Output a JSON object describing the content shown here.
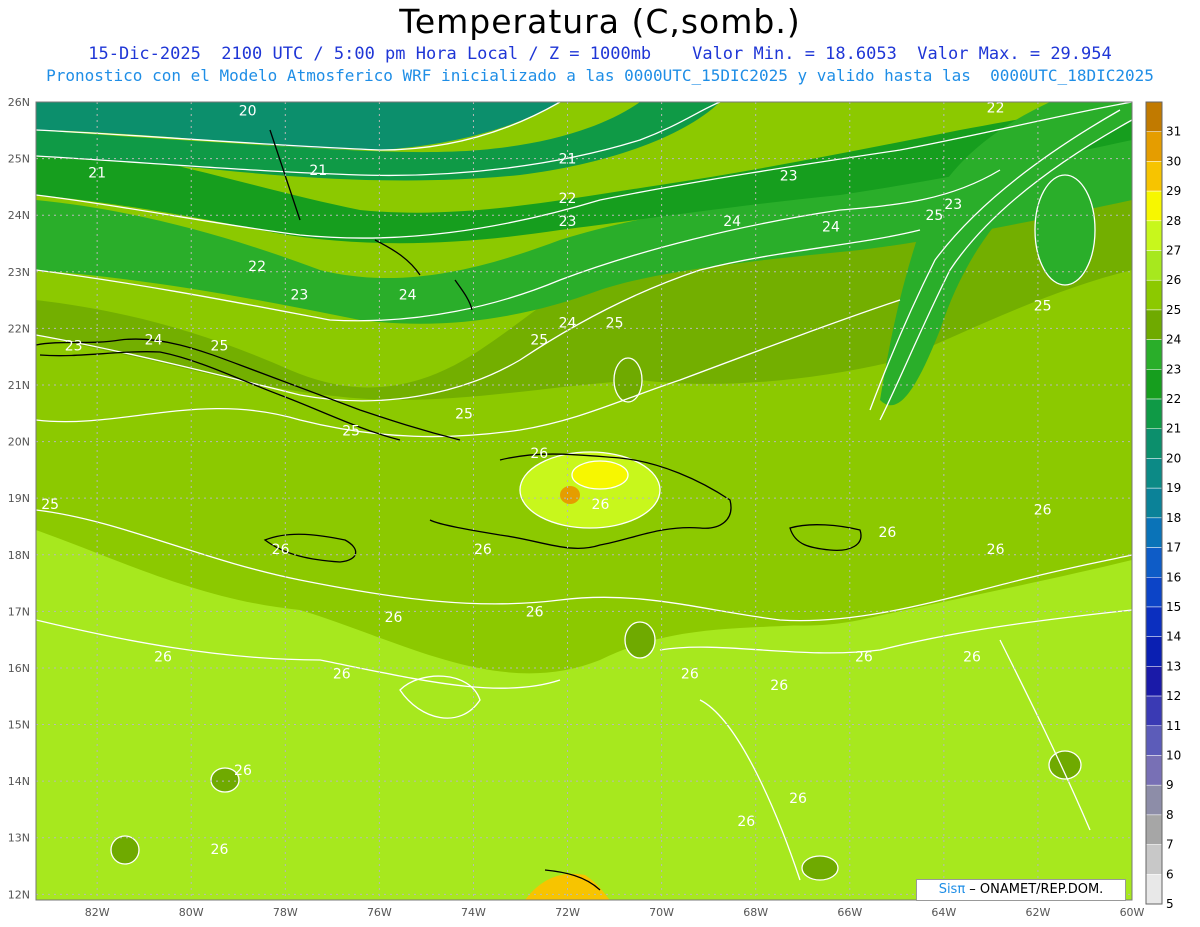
{
  "header": {
    "title": "Temperatura (C,somb.)",
    "line1": "15-Dic-2025  2100 UTC / 5:00 pm Hora Local / Z = 1000mb    Valor Min. = 18.6053  Valor Max. = 29.954",
    "line2": "Pronostico con el Modelo Atmosferico WRF inicializado a las 0000UTC_15DIC2025 y valido hasta las  0000UTC_18DIC2025"
  },
  "axes": {
    "lat_labels": [
      "26N",
      "25N",
      "24N",
      "23N",
      "22N",
      "21N",
      "20N",
      "19N",
      "18N",
      "17N",
      "16N",
      "15N",
      "14N",
      "13N",
      "12N"
    ],
    "lon_labels": [
      "82W",
      "80W",
      "78W",
      "76W",
      "74W",
      "72W",
      "70W",
      "68W",
      "66W",
      "64W",
      "62W",
      "60W"
    ]
  },
  "contour_labels": [
    {
      "text": "20",
      "lat": 25.85,
      "lon": -78.8
    },
    {
      "text": "21",
      "lat": 24.75,
      "lon": -82.0
    },
    {
      "text": "21",
      "lat": 24.8,
      "lon": -77.3
    },
    {
      "text": "21",
      "lat": 25.0,
      "lon": -72.0
    },
    {
      "text": "22",
      "lat": 24.3,
      "lon": -72.0
    },
    {
      "text": "22",
      "lat": 23.1,
      "lon": -78.6
    },
    {
      "text": "22",
      "lat": 25.9,
      "lon": -62.9
    },
    {
      "text": "23",
      "lat": 22.6,
      "lon": -77.7
    },
    {
      "text": "23",
      "lat": 23.9,
      "lon": -72.0
    },
    {
      "text": "23",
      "lat": 24.7,
      "lon": -67.3
    },
    {
      "text": "23",
      "lat": 24.2,
      "lon": -63.8
    },
    {
      "text": "23",
      "lat": 21.7,
      "lon": -82.5
    },
    {
      "text": "24",
      "lat": 22.6,
      "lon": -75.4
    },
    {
      "text": "24",
      "lat": 21.8,
      "lon": -80.8
    },
    {
      "text": "24",
      "lat": 22.1,
      "lon": -72.0
    },
    {
      "text": "24",
      "lat": 23.9,
      "lon": -68.5
    },
    {
      "text": "24",
      "lat": 23.8,
      "lon": -66.4
    },
    {
      "text": "25",
      "lat": 21.7,
      "lon": -79.4
    },
    {
      "text": "25",
      "lat": 21.8,
      "lon": -72.6
    },
    {
      "text": "25",
      "lat": 22.1,
      "lon": -71.0
    },
    {
      "text": "25",
      "lat": 24.0,
      "lon": -64.2
    },
    {
      "text": "25",
      "lat": 22.4,
      "lon": -61.9
    },
    {
      "text": "25",
      "lat": 20.2,
      "lon": -76.6
    },
    {
      "text": "25",
      "lat": 20.5,
      "lon": -74.2
    },
    {
      "text": "25",
      "lat": 18.9,
      "lon": -83.0
    },
    {
      "text": "26",
      "lat": 19.8,
      "lon": -72.6
    },
    {
      "text": "26",
      "lat": 18.9,
      "lon": -71.3
    },
    {
      "text": "26",
      "lat": 18.1,
      "lon": -78.1
    },
    {
      "text": "26",
      "lat": 18.1,
      "lon": -73.8
    },
    {
      "text": "26",
      "lat": 18.4,
      "lon": -65.2
    },
    {
      "text": "26",
      "lat": 18.1,
      "lon": -62.9
    },
    {
      "text": "26",
      "lat": 18.8,
      "lon": -61.9
    },
    {
      "text": "26",
      "lat": 16.9,
      "lon": -75.7
    },
    {
      "text": "26",
      "lat": 17.0,
      "lon": -72.7
    },
    {
      "text": "26",
      "lat": 16.2,
      "lon": -80.6
    },
    {
      "text": "26",
      "lat": 16.2,
      "lon": -65.7
    },
    {
      "text": "26",
      "lat": 16.2,
      "lon": -63.4
    },
    {
      "text": "26",
      "lat": 15.9,
      "lon": -69.4
    },
    {
      "text": "26",
      "lat": 15.9,
      "lon": -76.8
    },
    {
      "text": "26",
      "lat": 15.7,
      "lon": -67.5
    },
    {
      "text": "26",
      "lat": 14.2,
      "lon": -78.9
    },
    {
      "text": "26",
      "lat": 13.7,
      "lon": -67.1
    },
    {
      "text": "26",
      "lat": 13.3,
      "lon": -68.2
    },
    {
      "text": "26",
      "lat": 12.8,
      "lon": -79.4
    }
  ],
  "colorbar": {
    "labels": [
      "31",
      "30",
      "29",
      "28",
      "27",
      "26",
      "25",
      "24",
      "23",
      "22",
      "21",
      "20",
      "19",
      "18",
      "17",
      "16",
      "15",
      "14",
      "13",
      "12",
      "11",
      "10",
      "9",
      "8",
      "7",
      "6",
      "5"
    ],
    "colors": [
      "#c17a00",
      "#e59d00",
      "#f7c400",
      "#f7f700",
      "#c8f71c",
      "#a7e81e",
      "#8cc900",
      "#6faa00",
      "#2aae2a",
      "#169e1e",
      "#0f9a46",
      "#0c8f6c",
      "#0c8a86",
      "#0b8298",
      "#0a73b8",
      "#0e5cc7",
      "#0c44c7",
      "#0b2fbf",
      "#0a1fb2",
      "#1a1aa8",
      "#3a3ab4",
      "#5c5cb9",
      "#7870b5",
      "#8d8da8",
      "#a6a6a6",
      "#c8c8c8",
      "#e8e8e8"
    ]
  },
  "credit": {
    "sis": "Sisπ",
    "text": " – ONAMET/REP.DOM."
  }
}
